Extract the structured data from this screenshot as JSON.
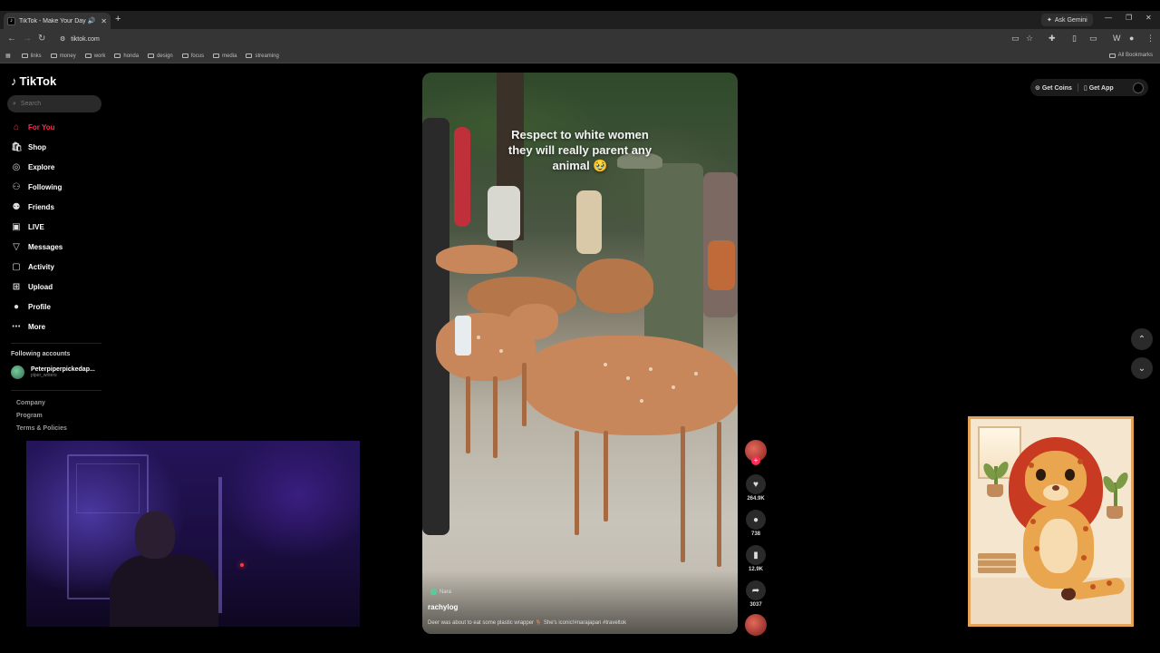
{
  "browser": {
    "tab_title": "TikTok - Make Your Day",
    "tab_favicon": "tiktok-icon",
    "tab_speaker": "speaker-icon",
    "new_tab": "+",
    "address": "tiktok.com",
    "gemini_label": "Ask Gemini",
    "bookmarks": [
      "links",
      "money",
      "work",
      "honda",
      "design",
      "focus",
      "media",
      "streaming"
    ],
    "all_bookmarks": "All Bookmarks"
  },
  "tiktok": {
    "logo": "TikTok",
    "search_placeholder": "Search",
    "nav": [
      {
        "label": "For You",
        "icon": "home-icon",
        "active": true
      },
      {
        "label": "Shop",
        "icon": "shop-icon"
      },
      {
        "label": "Explore",
        "icon": "compass-icon"
      },
      {
        "label": "Following",
        "icon": "following-icon"
      },
      {
        "label": "Friends",
        "icon": "friends-icon"
      },
      {
        "label": "LIVE",
        "icon": "live-icon"
      },
      {
        "label": "Messages",
        "icon": "messages-icon"
      },
      {
        "label": "Activity",
        "icon": "activity-icon"
      },
      {
        "label": "Upload",
        "icon": "upload-icon"
      },
      {
        "label": "Profile",
        "icon": "profile-icon"
      },
      {
        "label": "More",
        "icon": "more-icon"
      }
    ],
    "following_title": "Following accounts",
    "following_account": {
      "name": "Peterpiperpickedap...",
      "handle": "piper_writers"
    },
    "footer": [
      "Company",
      "Program",
      "Terms & Policies"
    ],
    "top_right": {
      "coins": "Get Coins",
      "app": "Get App"
    }
  },
  "video": {
    "overlay_lines": [
      "Respect to white women",
      "they will really parent any",
      "animal 🥹"
    ],
    "tag": "Nara",
    "author": "rachylog",
    "description": "Deer was about to eat some plastic wrapper 🦌 She's iconic!#narajapan #traveltok"
  },
  "actions": {
    "likes": "264.9K",
    "comments": "738",
    "saves": "12.9K",
    "shares": "3037"
  },
  "colors": {
    "accent": "#fe2c55",
    "background": "#000000"
  }
}
